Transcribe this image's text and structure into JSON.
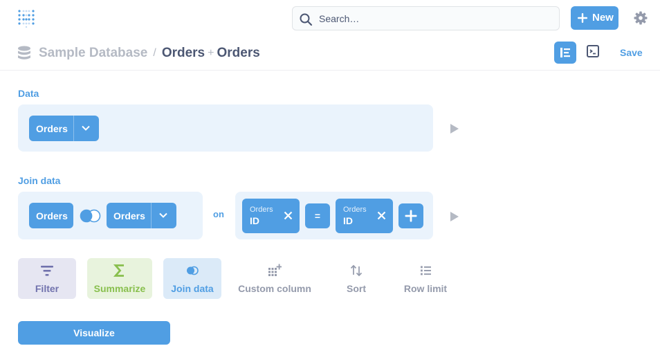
{
  "header": {
    "logo": "metabase-logo",
    "search": {
      "placeholder": "Search…",
      "icon": "search-icon"
    },
    "new_button": {
      "label": "New",
      "icon": "plus-icon"
    },
    "settings_icon": "gear-icon"
  },
  "breadcrumb": {
    "database_icon": "database-icon",
    "database": "Sample Database",
    "separator": "/",
    "table_a": "Orders",
    "plus": "+",
    "table_b": "Orders"
  },
  "view_toggle": {
    "editor_icon": "notebook-icon",
    "sql_icon": "sql-console-icon"
  },
  "save_label": "Save",
  "data_step": {
    "label": "Data",
    "table": "Orders",
    "preview_icon": "play-icon"
  },
  "join_step": {
    "label": "Join data",
    "left_table": "Orders",
    "join_type_icon": "left-join-icon",
    "right_table": "Orders",
    "on_label": "on",
    "left_column": {
      "table": "Orders",
      "column": "ID"
    },
    "operator": "=",
    "right_column": {
      "table": "Orders",
      "column": "ID"
    },
    "add_condition_icon": "plus-icon",
    "preview_icon": "play-icon"
  },
  "actions": [
    {
      "label": "Filter",
      "icon": "filter-icon"
    },
    {
      "label": "Summarize",
      "icon": "sum-icon"
    },
    {
      "label": "Join data",
      "icon": "join-icon"
    },
    {
      "label": "Custom column",
      "icon": "add-column-icon"
    },
    {
      "label": "Sort",
      "icon": "sort-icon"
    },
    {
      "label": "Row limit",
      "icon": "list-icon"
    }
  ],
  "visualize_label": "Visualize",
  "colors": {
    "brand": "#509ee3",
    "panel": "#eaf3fc",
    "filter": "#7172ad",
    "summarize": "#88bf4d"
  }
}
